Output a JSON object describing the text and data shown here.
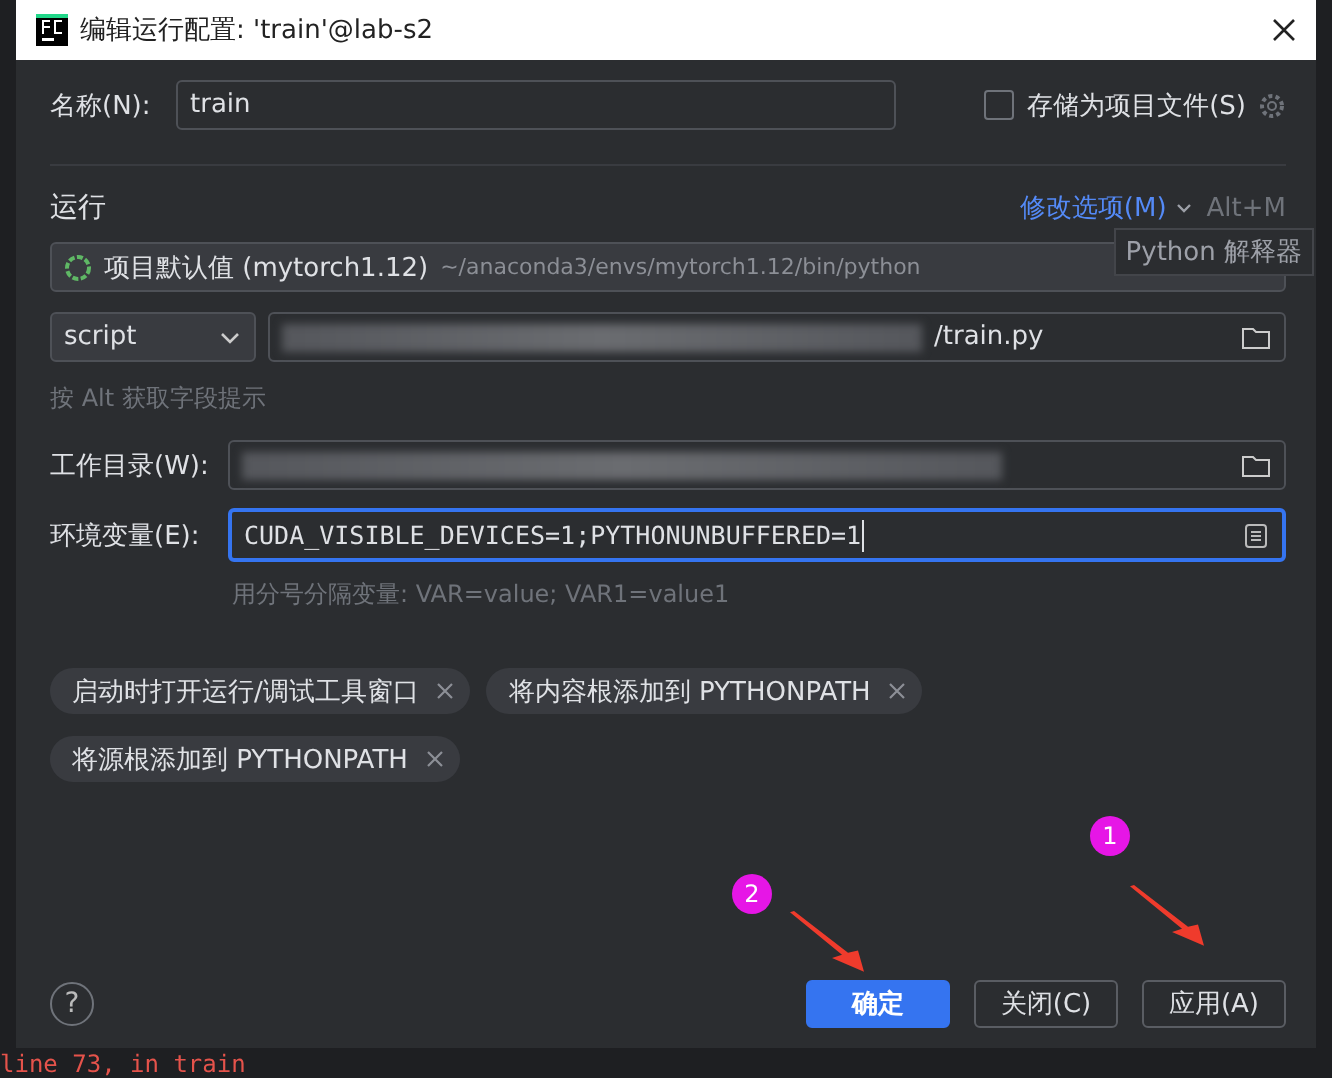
{
  "window": {
    "title": "编辑运行配置: 'train'@lab-s2"
  },
  "name_field": {
    "label": "名称(N):",
    "value": "train"
  },
  "store_as_project_file": {
    "label": "存储为项目文件(S)",
    "checked": false
  },
  "run_section": {
    "title": "运行",
    "modify_options": "修改选项(M)",
    "shortcut": "Alt+M",
    "tooltip": "Python 解释器"
  },
  "interpreter": {
    "name": "项目默认值 (mytorch1.12)",
    "path": "~/anaconda3/envs/mytorch1.12/bin/python"
  },
  "script_type": "script",
  "script_path": {
    "value": "/train.py"
  },
  "alt_hint": "按 Alt 获取字段提示",
  "working_dir": {
    "label": "工作目录(W):"
  },
  "env_vars": {
    "label": "环境变量(E):",
    "value": "CUDA_VISIBLE_DEVICES=1;PYTHONUNBUFFERED=1",
    "hint": "用分号分隔变量: VAR=value; VAR1=value1"
  },
  "chips": [
    {
      "label": "启动时打开运行/调试工具窗口"
    },
    {
      "label": "将内容根添加到 PYTHONPATH"
    },
    {
      "label": "将源根添加到 PYTHONPATH"
    }
  ],
  "buttons": [
    {
      "label": "确定",
      "kind": "primary"
    },
    {
      "label": "关闭(C)",
      "kind": "secondary"
    },
    {
      "label": "应用(A)",
      "kind": "secondary"
    }
  ],
  "help_button": "?",
  "annotations": [
    {
      "number": "1"
    },
    {
      "number": "2"
    }
  ],
  "background_text": "line 73, in train"
}
